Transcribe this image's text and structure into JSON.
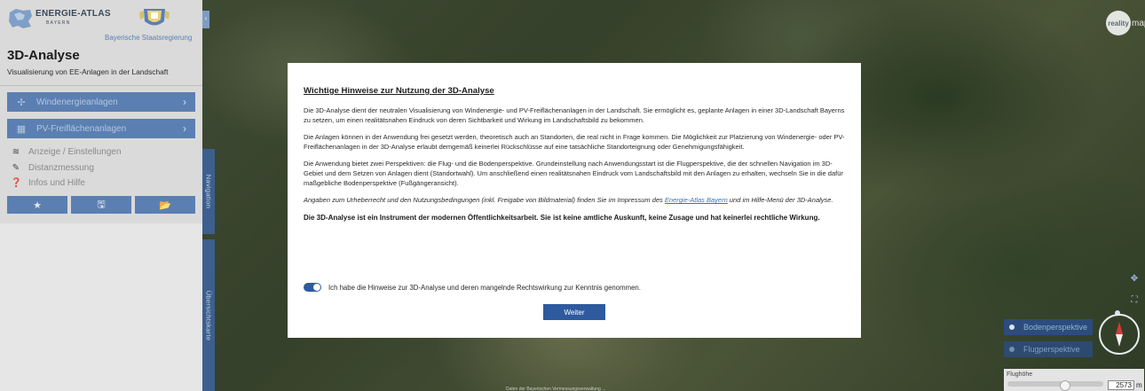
{
  "sidebar": {
    "logo_title": "ENERGIE-ATLAS",
    "logo_subtitle": "BAYERN",
    "government_label": "Bayerische Staatsregierung",
    "app_title": "3D-Analyse",
    "app_subtitle": "Visualisierung von EE-Anlagen in der Landschaft",
    "nav_buttons": [
      {
        "label": "Windenergieanlagen",
        "icon": "wind-turbine-icon"
      },
      {
        "label": "PV-Freiflächenanlagen",
        "icon": "solar-panel-icon"
      }
    ],
    "menu_items": [
      {
        "label": "Anzeige / Einstellungen",
        "icon": "layers-icon"
      },
      {
        "label": "Distanzmessung",
        "icon": "ruler-pen-icon"
      },
      {
        "label": "Infos und Hilfe",
        "icon": "help-icon"
      }
    ],
    "tools": [
      {
        "icon": "star-icon",
        "glyph": "★"
      },
      {
        "icon": "save-icon",
        "glyph": "🖫"
      },
      {
        "icon": "folder-open-icon",
        "glyph": "📂"
      }
    ]
  },
  "side_tabs": {
    "navigation": "Navigation",
    "overview": "Übersichtskarte"
  },
  "brand": {
    "reality": "reality",
    "maps": "maps"
  },
  "map_controls": {
    "ground_perspective": "Bodenperspektive",
    "flight_perspective": "Flugperspektive",
    "height_label": "Flughöhe",
    "height_value": "2573",
    "height_unit": "m",
    "height_fraction": 0.6
  },
  "attribution": "Daten der Bayerischen Vermessungsverwaltung ...",
  "modal": {
    "title": "Wichtige Hinweise zur Nutzung der 3D-Analyse",
    "p1": "Die 3D-Analyse dient der neutralen Visualisierung von Windenergie- und PV-Freiflächenanlagen in der Landschaft. Sie ermöglicht es, geplante Anlagen in einer 3D-Landschaft Bayerns zu setzen, um einen realitätsnahen Eindruck von deren Sichtbarkeit und Wirkung im Landschaftsbild zu bekommen.",
    "p2": "Die Anlagen können in der Anwendung frei gesetzt werden, theoretisch auch an Standorten, die real nicht in Frage kommen. Die Möglichkeit zur Platzierung von Windenergie- oder PV-Freiflächenanlagen in der 3D-Analyse erlaubt demgemäß keinerlei Rückschlüsse auf eine tatsächliche Standorteignung oder Genehmigungsfähigkeit.",
    "p3": "Die Anwendung bietet zwei Perspektiven: die Flug- und die Bodenperspektive. Grundeinstellung nach Anwendungsstart ist die Flugperspektive, die der schnellen Navigation im 3D-Gebiet und dem Setzen von Anlagen dient (Standortwahl). Um anschließend einen realitätsnahen Eindruck vom Landschaftsbild mit den Anlagen zu erhalten, wechseln Sie in die dafür maßgebliche Bodenperspektive (Fußgängeransicht).",
    "p4_before": "Angaben zum Urheberrecht und den Nutzungsbedingungen (inkl. Freigabe von Bildmaterial) finden Sie im Impressum des ",
    "p4_link": "Energie-Atlas Bayern",
    "p4_after": " und im Hilfe-Menü der 3D-Analyse.",
    "p5": "Die 3D-Analyse ist ein Instrument der modernen Öffentlichkeitsarbeit. Sie ist keine amtliche Auskunft, keine Zusage und hat keinerlei rechtliche Wirkung.",
    "ack_label": "Ich habe die Hinweise zur 3D-Analyse und deren mangelnde Rechtswirkung zur Kenntnis genommen.",
    "ack_checked": true,
    "continue_label": "Weiter"
  },
  "colors": {
    "primary": "#5b7fb2",
    "dark_primary": "#2e5a9e",
    "sidebar_bg": "#dadada"
  }
}
